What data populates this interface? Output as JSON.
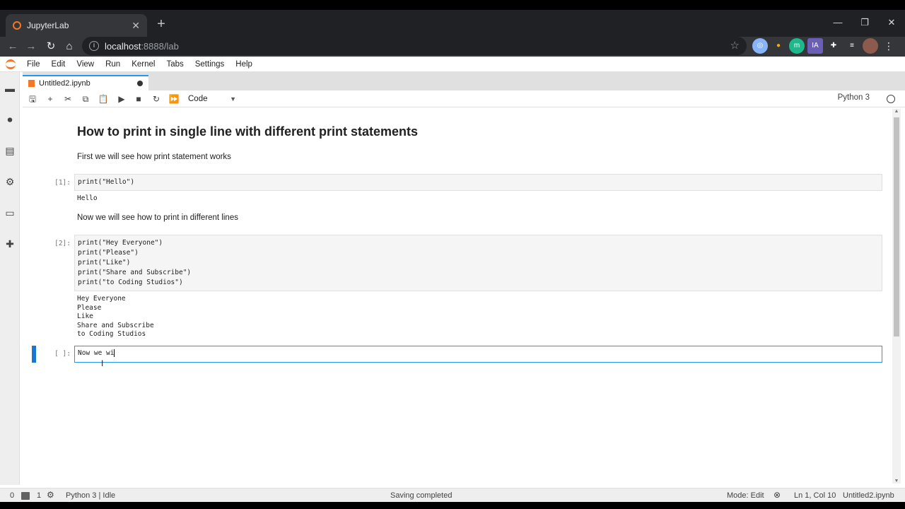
{
  "browser": {
    "tab_title": "JupyterLab",
    "tab_close": "✕",
    "new_tab": "+",
    "window_controls": [
      "—",
      "❐",
      "✕"
    ],
    "url_host": "localhost",
    "url_rest": ":8888/lab",
    "extensions": [
      {
        "label": "◎",
        "color": "#8ab4f8"
      },
      {
        "label": "●",
        "color": "#f9ab00"
      },
      {
        "label": "m",
        "color": "#1db98c"
      },
      {
        "label": "IA",
        "color": "#6b5fb5"
      },
      {
        "label": "✚",
        "color": "#5f6368"
      },
      {
        "label": "≡",
        "color": "#5f6368"
      },
      {
        "label": "●",
        "color": "#8d5a4e"
      },
      {
        "label": "⋮",
        "color": "#202124"
      }
    ]
  },
  "menu": [
    "File",
    "Edit",
    "View",
    "Run",
    "Kernel",
    "Tabs",
    "Settings",
    "Help"
  ],
  "document_tab": {
    "title": "Untitled2.ipynb"
  },
  "toolbar": {
    "cell_type": "Code",
    "kernel": "Python 3"
  },
  "notebook": {
    "heading": "How to print in single line with different print statements",
    "md1": "First we will see how print statement works",
    "cell1": {
      "prompt": "[1]:",
      "code": "print(\"Hello\")",
      "output": "Hello"
    },
    "md2": "Now we will see how to print in different lines",
    "cell2": {
      "prompt": "[2]:",
      "code": "print(\"Hey Everyone\")\nprint(\"Please\")\nprint(\"Like\")\nprint(\"Share and Subscribe\")\nprint(\"to Coding Studios\")",
      "output": "Hey Everyone\nPlease\nLike\nShare and Subscribe\nto Coding Studios"
    },
    "cell3": {
      "prompt": "[ ]:",
      "code": "Now we wi"
    }
  },
  "status": {
    "zero": "0",
    "one": "1",
    "kernel": "Python 3 | Idle",
    "saving": "Saving completed",
    "mode": "Mode: Edit",
    "position": "Ln 1, Col 10",
    "file": "Untitled2.ipynb"
  }
}
